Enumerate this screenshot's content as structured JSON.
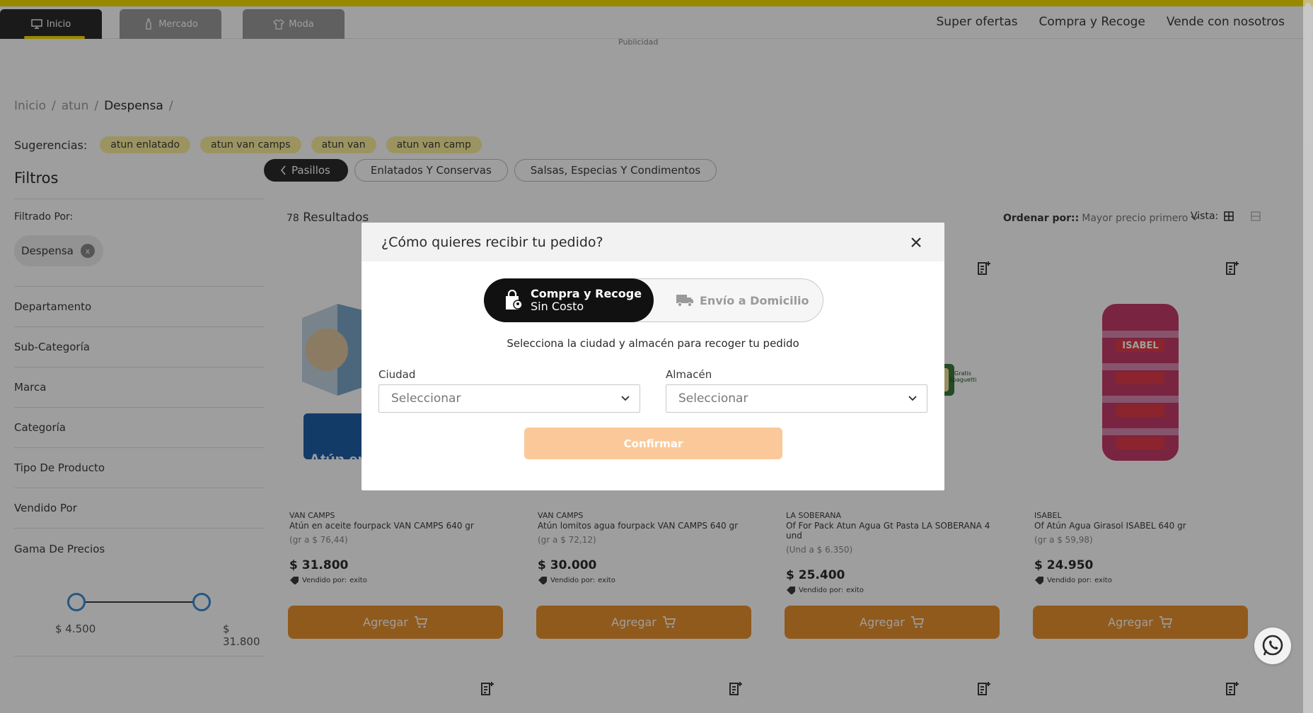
{
  "topnav": {
    "tabs": [
      {
        "label": "Inicio",
        "icon": "monitor-icon"
      },
      {
        "label": "Mercado",
        "icon": "bottle-icon"
      },
      {
        "label": "Moda",
        "icon": "shirt-icon"
      }
    ],
    "links": [
      "Super ofertas",
      "Compra y Recoge",
      "Vende con nosotros"
    ],
    "ad_label": "Publicidad"
  },
  "breadcrumb": {
    "items": [
      "Inicio",
      "atun",
      "Despensa"
    ],
    "separator": "/"
  },
  "suggestions": {
    "label": "Sugerencias:",
    "items": [
      "atun enlatado",
      "atun van camps",
      "atun van",
      "atun van camp"
    ]
  },
  "aisles": {
    "back_label": "Pasillos",
    "items": [
      "Enlatados Y Conservas",
      "Salsas, Especias Y Condimentos"
    ]
  },
  "sidebar": {
    "title": "Filtros",
    "filtered_by_label": "Filtrado Por:",
    "active_filter": "Despensa",
    "active_filter_remove": "x",
    "filters": [
      "Departamento",
      "Sub-Categoría",
      "Marca",
      "Categoría",
      "Tipo De Producto",
      "Vendido Por",
      "Gama De Precios"
    ],
    "price_min": "$ 4.500",
    "price_max": "$ 31.800"
  },
  "results": {
    "count": "78",
    "label": "Resultados",
    "sort_label": "Ordenar por::",
    "sort_value": "Mayor precio primero",
    "view_label": "Vista:"
  },
  "products": [
    {
      "brand": "VAN CAMPS",
      "name": "Atún en aceite fourpack VAN CAMPS 640 gr",
      "unit_price": "(gr a $ 76,44)",
      "price": "$ 31.800",
      "seller_label": "Vendido por:",
      "seller": "exito",
      "button": "Agregar",
      "image_text": "Atún en"
    },
    {
      "brand": "VAN CAMPS",
      "name": "Atún lomitos agua fourpack VAN CAMPS 640 gr",
      "unit_price": "(gr a $ 72,12)",
      "price": "$ 30.000",
      "seller_label": "Vendido por:",
      "seller": "exito",
      "button": "Agregar"
    },
    {
      "brand": "LA SOBERANA",
      "name": "Of For Pack Atun Agua Gt Pasta LA SOBERANA 4 und",
      "unit_price": "(Und a $ 6.350)",
      "price": "$ 25.400",
      "seller_label": "Vendido por:",
      "seller": "exito",
      "button": "Agregar",
      "image_text": "Gratis Spaguetti"
    },
    {
      "brand": "ISABEL",
      "name": "Of Atún Agua Girasol ISABEL 640 gr",
      "unit_price": "(gr a $ 59,98)",
      "price": "$ 24.950",
      "seller_label": "Vendido por:",
      "seller": "exito",
      "button": "Agregar",
      "image_text": "ISABEL"
    }
  ],
  "modal": {
    "title": "¿Cómo quieres recibir tu pedido?",
    "option_active_line1": "Compra y Recoge",
    "option_active_line2": "Sin Costo",
    "option_inactive": "Envío a Domicilio",
    "instruction": "Selecciona la ciudad y almacén para recoger tu pedido",
    "city_label": "Ciudad",
    "city_value": "Seleccionar",
    "store_label": "Almacén",
    "store_value": "Seleccionar",
    "confirm": "Confirmar"
  },
  "colors": {
    "brand_yellow": "#f5dc00",
    "accent_orange": "#e8912f",
    "confirm_disabled": "#fbc999",
    "dark": "#111111"
  }
}
